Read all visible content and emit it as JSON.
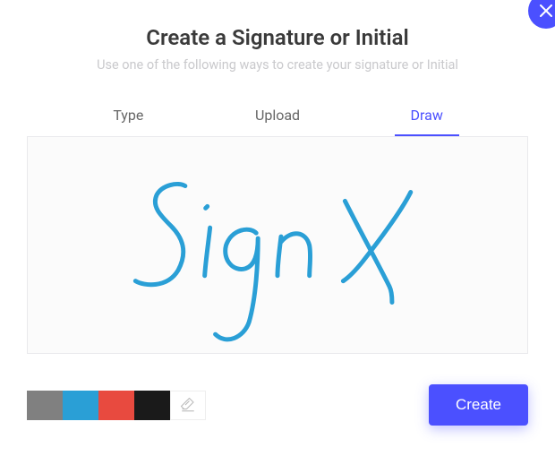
{
  "header": {
    "title": "Create a Signature or Initial",
    "subtitle": "Use one of the following ways to create your signature or Initial"
  },
  "tabs": {
    "type": "Type",
    "upload": "Upload",
    "draw": "Draw",
    "active": "draw"
  },
  "swatches": {
    "gray": "#808080",
    "blue": "#2a9fd6",
    "red": "#e84a3f",
    "black": "#1a1a1a",
    "selected": "blue"
  },
  "buttons": {
    "create": "Create"
  },
  "signature": {
    "stroke_color": "#2a9fd6",
    "content": "SignX"
  }
}
